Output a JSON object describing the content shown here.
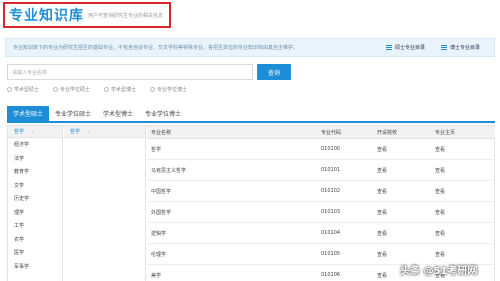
{
  "header": {
    "title": "专业知识库",
    "subtitle": "用户可查询研究生专业的相关信息"
  },
  "notice": {
    "text": "专业知识库下的专业为研究生招生的基础专业，不包含自设专业、交叉学科等特殊专业。各招生单位的专业知识库由其自主维护。",
    "links": [
      "硕士专业目录",
      "博士专业目录"
    ]
  },
  "search": {
    "placeholder": "请输入专业名称",
    "button": "查询"
  },
  "radios": [
    "学术型硕士",
    "专业学位硕士",
    "学术型博士",
    "专业学位博士"
  ],
  "tabs": [
    "学术型硕士",
    "专业学位硕士",
    "学术型博士",
    "专业学位博士"
  ],
  "categories": {
    "header": "哲学",
    "items": [
      "经济学",
      "法学",
      "教育学",
      "文学",
      "历史学",
      "理学",
      "工学",
      "农学",
      "医学",
      "军事学"
    ]
  },
  "subcategories": {
    "header": "哲学"
  },
  "table": {
    "columns": [
      "专业名称",
      "专业代码",
      "开设院校",
      "专业主页"
    ],
    "rows": [
      [
        "哲学",
        "010100",
        "查看",
        "查看"
      ],
      [
        "马克思主义哲学",
        "010101",
        "查看",
        "查看"
      ],
      [
        "中国哲学",
        "010102",
        "查看",
        "查看"
      ],
      [
        "外国哲学",
        "010103",
        "查看",
        "查看"
      ],
      [
        "逻辑学",
        "010104",
        "查看",
        "查看"
      ],
      [
        "伦理学",
        "010105",
        "查看",
        "查看"
      ],
      [
        "美学",
        "010106",
        "查看",
        "查看"
      ]
    ]
  },
  "watermark": "头条 @51考研网",
  "colors": {
    "accent": "#1e8fd6",
    "title_border": "#d7262b",
    "notice_bg": "#e8f3fb"
  }
}
